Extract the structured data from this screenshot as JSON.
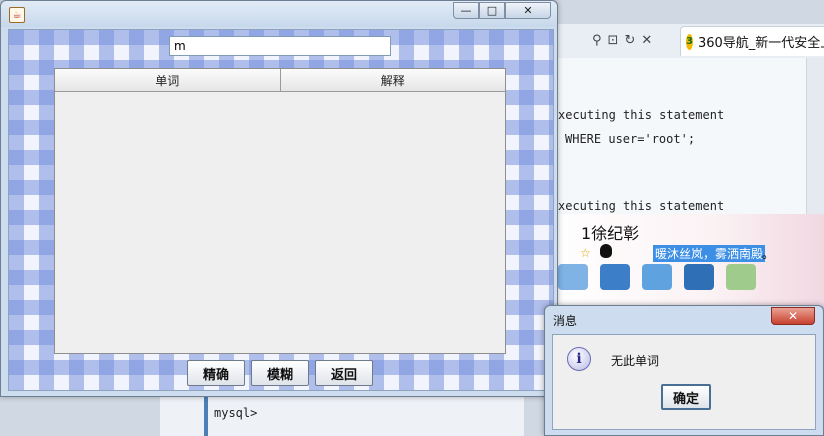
{
  "background": {
    "browser_tab": {
      "title": "360导航_新一代安全上"
    },
    "console_lines": [
      "xecuting this statement",
      "WHERE user='root';",
      "xecuting this statement"
    ],
    "chat": {
      "username": "1徐纪彰",
      "signature": "暖沐丝岚，雾洒南殿",
      "signature_end": "。"
    },
    "terminal_prompt": "mysql>"
  },
  "main_window": {
    "search": {
      "value": "m"
    },
    "table": {
      "columns": [
        "单词",
        "解释"
      ],
      "rows": []
    },
    "buttons": {
      "exact": "精确",
      "fuzzy": "模糊",
      "back": "返回"
    },
    "window_controls": {
      "minimize": "—",
      "maximize": "□",
      "close": "✕"
    }
  },
  "dialog": {
    "title": "消息",
    "message": "无此单词",
    "ok": "确定",
    "close": "✕"
  },
  "colors": {
    "checker": "#7891dc",
    "title_bar": "#cddcee",
    "selection": "#3d8fe6"
  }
}
